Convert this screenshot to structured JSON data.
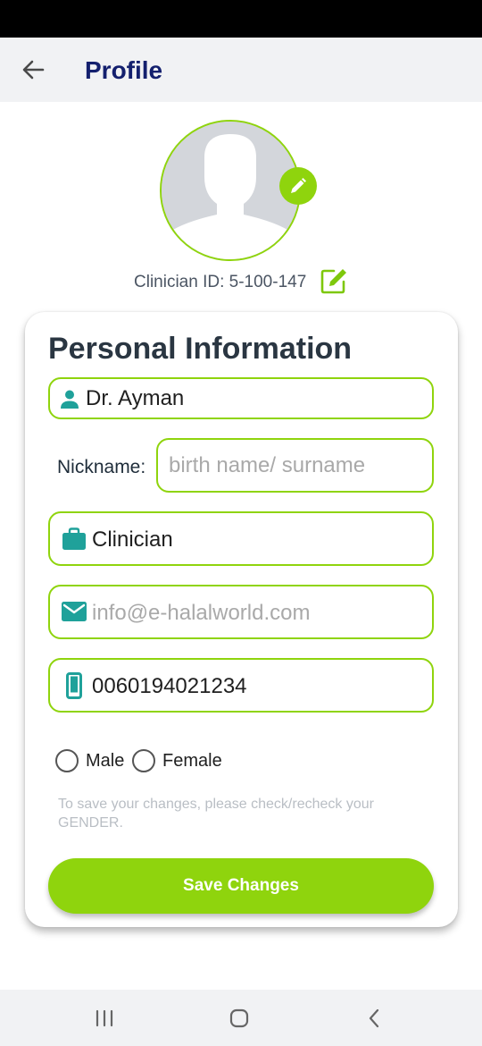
{
  "header": {
    "title": "Profile",
    "back_icon": "arrow-left-icon"
  },
  "profile": {
    "clinician_id": "Clinician ID: 5-100-147",
    "avatar_icon": "person-silhouette-icon",
    "edit_icon": "pencil-icon"
  },
  "form": {
    "section_title": "Personal Information",
    "name_value": "Dr. Ayman",
    "nickname_label": "Nickname:",
    "nickname_placeholder": "birth name/ surname",
    "role_value": "Clinician",
    "email_placeholder": "info@e-halalworld.com",
    "phone_value": "0060194021234",
    "gender_options": [
      "Male",
      "Female"
    ],
    "note": "To save your changes, please check/recheck your GENDER.",
    "save_label": "Save Changes"
  },
  "colors": {
    "accent": "#8fd40d",
    "title": "#14206e",
    "icon_teal": "#1fa19a"
  },
  "nav": [
    "recents-icon",
    "home-icon",
    "back-icon"
  ]
}
